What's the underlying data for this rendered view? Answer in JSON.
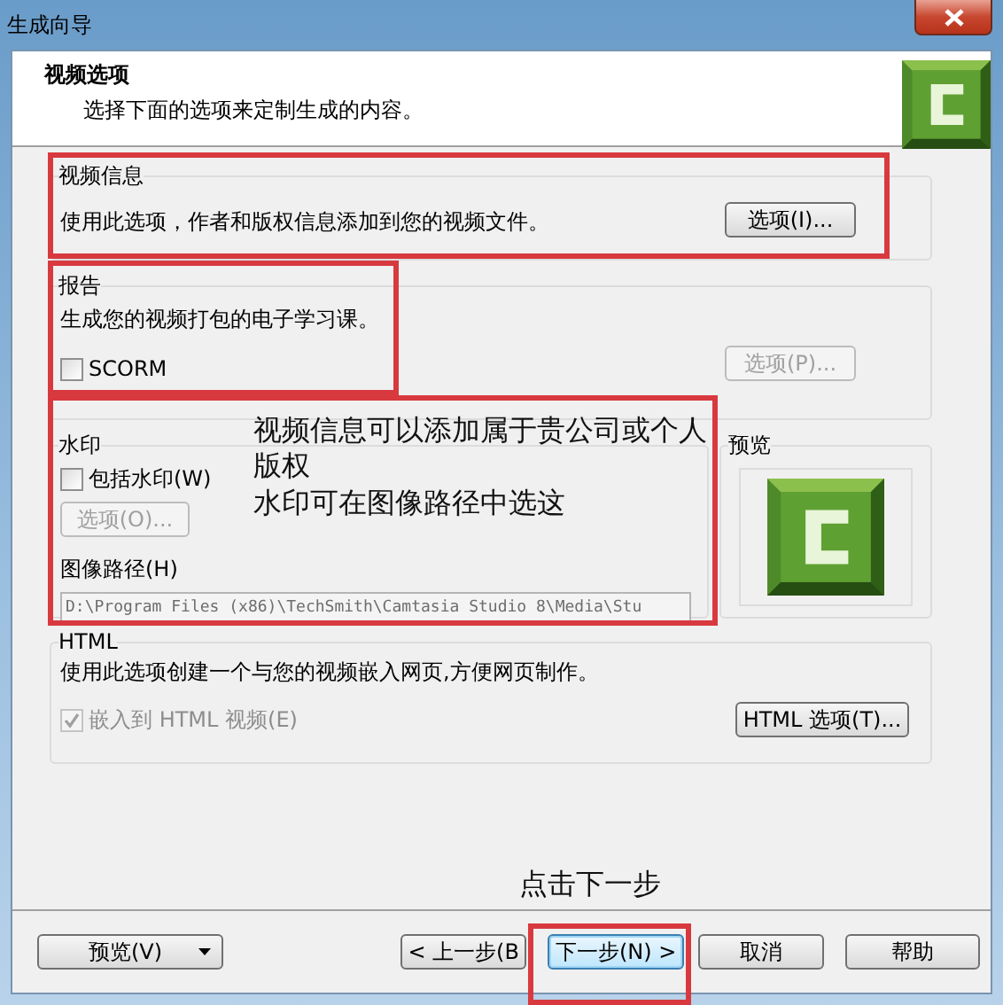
{
  "window": {
    "title": "生成向导"
  },
  "header": {
    "title": "视频选项",
    "subtitle": "选择下面的选项来定制生成的内容。"
  },
  "video_info": {
    "title": "视频信息",
    "description": "使用此选项，作者和版权信息添加到您的视频文件。",
    "button": {
      "label": "选项(I)...",
      "disabled": false
    }
  },
  "report": {
    "title": "报告",
    "description": "生成您的视频打包的电子学习课。",
    "checkbox": {
      "label": "SCORM",
      "checked": false,
      "disabled": false
    },
    "button": {
      "label": "选项(P)...",
      "disabled": true
    }
  },
  "watermark": {
    "title": "水印",
    "checkbox": {
      "label": "包括水印(W)",
      "checked": false,
      "disabled": false
    },
    "button": {
      "label": "选项(O)...",
      "disabled": true
    },
    "path_label": "图像路径(H)",
    "path_value": "D:\\Program Files (x86)\\TechSmith\\Camtasia Studio 8\\Media\\Stu"
  },
  "preview": {
    "title": "预览"
  },
  "html": {
    "title": "HTML",
    "description": "使用此选项创建一个与您的视频嵌入网页,方便网页制作。",
    "checkbox": {
      "label": "嵌入到 HTML 视频(E)",
      "checked": true,
      "disabled": true
    },
    "button": {
      "label": "HTML 选项(T)...",
      "disabled": false
    }
  },
  "footer": {
    "buttons": [
      {
        "kind": "dropdown",
        "label": "预览(V)",
        "default": false
      },
      {
        "kind": "back",
        "label": "< 上一步(B",
        "default": false
      },
      {
        "kind": "next",
        "label": "下一步(N) >",
        "default": true
      },
      {
        "kind": "cancel",
        "label": "取消",
        "default": false
      },
      {
        "kind": "help",
        "label": "帮助",
        "default": false
      }
    ]
  },
  "annotations": {
    "notes": [
      "视频信息可以添加属于贵公司或个人版权",
      "水印可在图像路径中选这"
    ],
    "hint": "点击下一步"
  }
}
